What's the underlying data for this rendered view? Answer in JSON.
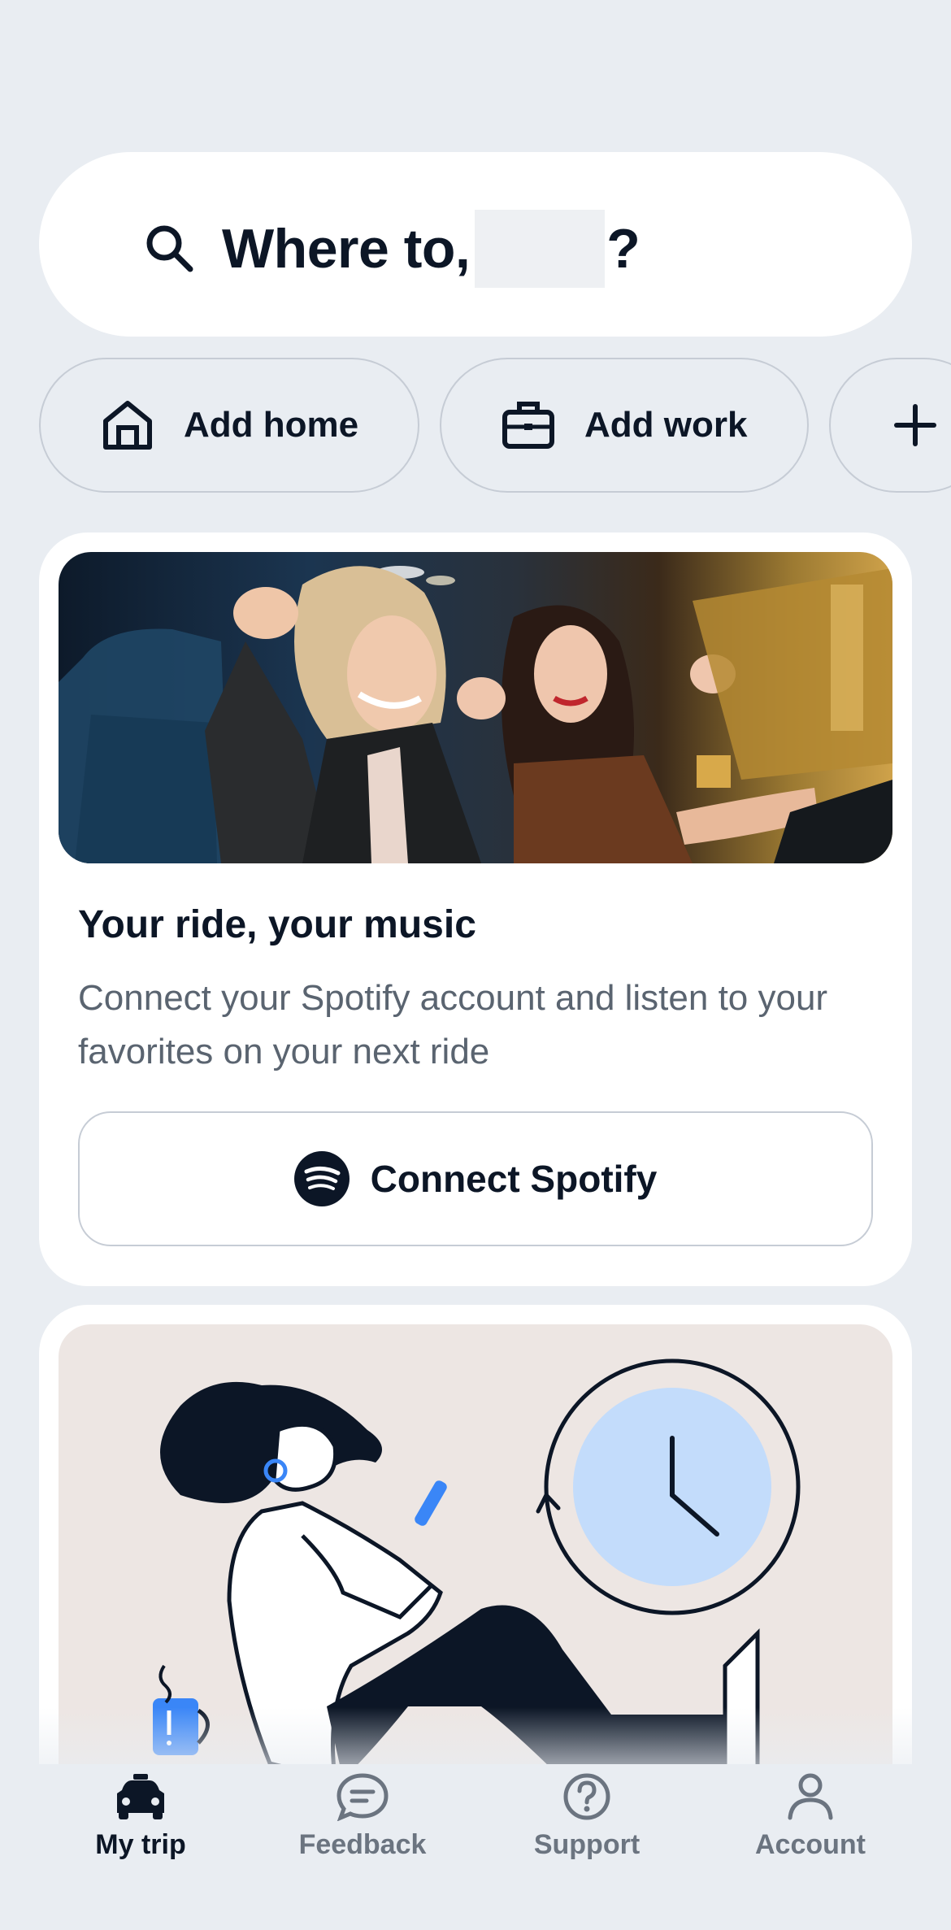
{
  "search": {
    "prefix": "Where to,",
    "suffix": "?",
    "icon": "search-icon"
  },
  "chips": {
    "home_label": "Add home",
    "work_label": "Add work",
    "home_icon": "home-icon",
    "work_icon": "briefcase-icon",
    "add_icon": "plus-icon"
  },
  "spotify_card": {
    "title": "Your ride, your music",
    "description": "Connect your Spotify account and listen to your favorites on your next ride",
    "button_label": "Connect Spotify",
    "button_icon": "spotify-icon"
  },
  "tabs": [
    {
      "label": "My trip",
      "icon": "car-icon",
      "active": true
    },
    {
      "label": "Feedback",
      "icon": "chat-bubble-icon",
      "active": false
    },
    {
      "label": "Support",
      "icon": "question-circle-icon",
      "active": false
    },
    {
      "label": "Account",
      "icon": "person-icon",
      "active": false
    }
  ],
  "colors": {
    "background": "#e9edf2",
    "text_primary": "#0c1626",
    "text_secondary": "#5a6470",
    "accent_blue": "#3a86f7",
    "clock_blue": "#c3dcfb"
  }
}
